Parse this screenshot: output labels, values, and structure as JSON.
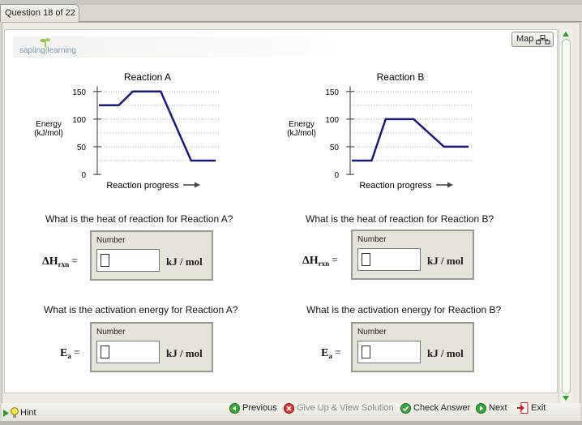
{
  "header": {
    "question_tab": "Question 18 of 22",
    "map_label": "Map"
  },
  "logo": {
    "part1": "sapling",
    "part2": "learning"
  },
  "reaction_a": {
    "chart_data": {
      "type": "line",
      "title": "Reaction A",
      "xlabel": "Reaction progress",
      "ylabel": "Energy",
      "ylabel_unit": "(kJ/mol)",
      "yticks": [
        0,
        50,
        100,
        150
      ],
      "ylim": [
        0,
        160
      ],
      "grid": true,
      "x": [
        0.0,
        0.17,
        0.29,
        0.53,
        0.79,
        1.0
      ],
      "values": [
        125,
        125,
        150,
        150,
        25,
        25
      ]
    },
    "heat_question": "What is the heat of reaction for Reaction A?",
    "activation_question": "What is the activation energy for Reaction A?",
    "dh_label": {
      "symbol": "ΔH",
      "sub": "rxn",
      "eq": "="
    },
    "ea_label": {
      "symbol": "E",
      "sub": "a",
      "eq": "="
    },
    "heat_box": {
      "label": "Number",
      "value": "",
      "unit": "kJ / mol"
    },
    "activation_box": {
      "label": "Number",
      "value": "",
      "unit": "kJ / mol"
    }
  },
  "reaction_b": {
    "chart_data": {
      "type": "line",
      "title": "Reaction B",
      "xlabel": "Reaction progress",
      "ylabel": "Energy",
      "ylabel_unit": "(kJ/mol)",
      "yticks": [
        0,
        50,
        100,
        150
      ],
      "ylim": [
        0,
        160
      ],
      "grid": true,
      "x": [
        0.0,
        0.17,
        0.29,
        0.53,
        0.79,
        1.0
      ],
      "values": [
        25,
        25,
        100,
        100,
        50,
        50
      ]
    },
    "heat_question": "What is the heat of reaction for Reaction B?",
    "activation_question": "What is the activation energy for Reaction B?",
    "dh_label": {
      "symbol": "ΔH",
      "sub": "rxn",
      "eq": "="
    },
    "ea_label": {
      "symbol": "E",
      "sub": "a",
      "eq": "="
    },
    "heat_box": {
      "label": "Number",
      "value": "",
      "unit": "kJ / mol"
    },
    "activation_box": {
      "label": "Number",
      "value": "",
      "unit": "kJ / mol"
    }
  },
  "footer": {
    "hint": "Hint",
    "previous": "Previous",
    "give_up": "Give Up & View Solution",
    "check": "Check Answer",
    "next": "Next",
    "exit": "Exit"
  },
  "colors": {
    "curve": "#1a1a7a",
    "grid": "#aaaaaa",
    "accent_green": "#2f9a2f",
    "exit_red": "#c81e1e"
  }
}
